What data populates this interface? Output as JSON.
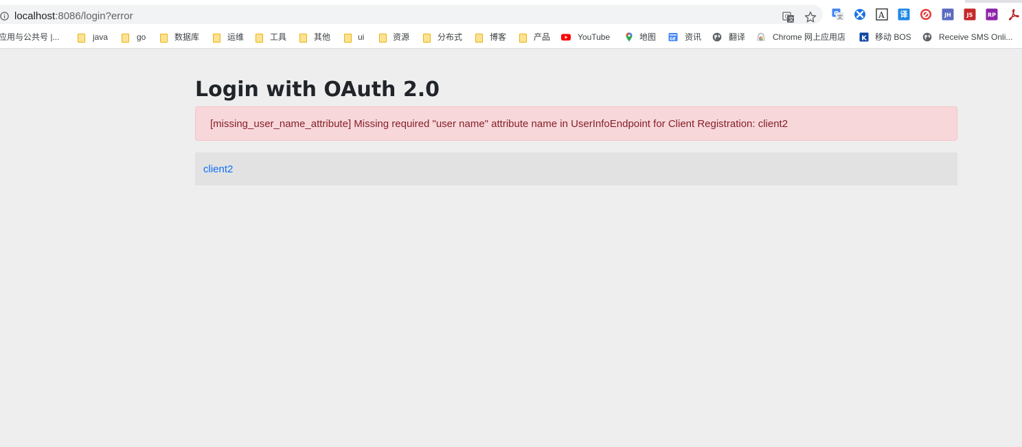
{
  "browser": {
    "url_host": "localhost",
    "url_rest": ":8086/login?error",
    "accent": "#1a73e8"
  },
  "bookmarks": [
    {
      "label": "应用与公共号 |...",
      "icon": "none"
    },
    {
      "label": "java",
      "icon": "folder-icon"
    },
    {
      "label": "go",
      "icon": "folder-icon"
    },
    {
      "label": "数据库",
      "icon": "folder-icon"
    },
    {
      "label": "运维",
      "icon": "folder-icon"
    },
    {
      "label": "工具",
      "icon": "folder-icon"
    },
    {
      "label": "其他",
      "icon": "folder-icon"
    },
    {
      "label": "ui",
      "icon": "folder-icon"
    },
    {
      "label": "资源",
      "icon": "folder-icon"
    },
    {
      "label": "分布式",
      "icon": "folder-icon"
    },
    {
      "label": "博客",
      "icon": "folder-icon"
    },
    {
      "label": "产品",
      "icon": "folder-icon"
    },
    {
      "label": "YouTube",
      "icon": "youtube-icon"
    },
    {
      "label": "地图",
      "icon": "maps-icon"
    },
    {
      "label": "资讯",
      "icon": "news-icon"
    },
    {
      "label": "翻译",
      "icon": "globe-icon"
    },
    {
      "label": "Chrome 网上应用店",
      "icon": "webstore-icon"
    },
    {
      "label": "移动 BOS",
      "icon": "k-icon"
    },
    {
      "label": "Receive SMS Onli...",
      "icon": "globe-icon"
    }
  ],
  "extensions": [
    {
      "name": "google-translate-icon",
      "text": "G",
      "color": "#4285f4"
    },
    {
      "name": "blue-circle-extension-icon",
      "text": "",
      "color": "#1a73e8"
    },
    {
      "name": "a-dictionary-icon",
      "text": "A",
      "color": "#ffffff"
    },
    {
      "name": "translate-extension-icon",
      "text": "译",
      "color": "#1e88e5"
    },
    {
      "name": "red-circle-extension-icon",
      "text": "",
      "color": "#e53935"
    },
    {
      "name": "jh-extension-icon",
      "text": "JH",
      "color": "#5c6bc0"
    },
    {
      "name": "js-extension-icon",
      "text": "JS",
      "color": "#c62828"
    },
    {
      "name": "rp-extension-icon",
      "text": "RP",
      "color": "#8e24aa"
    },
    {
      "name": "pdf-extension-icon",
      "text": "",
      "color": "#b71c1c"
    }
  ],
  "page": {
    "title": "Login with OAuth 2.0",
    "error_message": "[missing_user_name_attribute] Missing required \"user name\" attribute name in UserInfoEndpoint for Client Registration: client2",
    "clients": [
      {
        "label": "client2"
      }
    ]
  }
}
